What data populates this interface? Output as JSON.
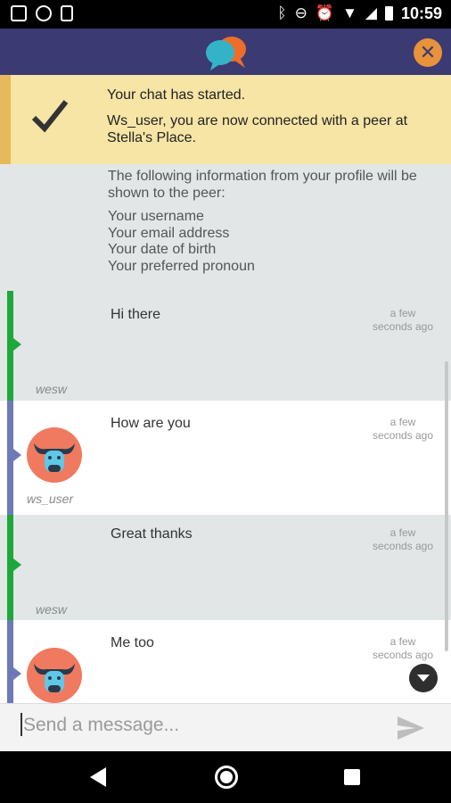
{
  "status_bar": {
    "time": "10:59",
    "left_icons": [
      "image-icon",
      "sync-icon",
      "phone-icon"
    ],
    "right_icons": [
      "bluetooth-icon",
      "dnd-icon",
      "alarm-icon",
      "wifi-icon",
      "signal-icon",
      "battery-icon"
    ]
  },
  "app_bar": {
    "logo_icon": "chat-bubbles-logo",
    "close_icon": "close-icon",
    "colors": {
      "background": "#3b3a73",
      "close": "#e8923a"
    }
  },
  "banner": {
    "title": "Your chat has started.",
    "text": "Ws_user, you are now connected with a peer at Stella's Place.",
    "icon": "checkmark-icon",
    "colors": {
      "background": "#f7e5a6",
      "stripe": "#e6b95a"
    }
  },
  "info": {
    "intro": "The following information from your profile will be shown to the peer:",
    "items": [
      "Your username",
      "Your email address",
      "Your date of birth",
      "Your preferred pronoun"
    ]
  },
  "messages": [
    {
      "text": "Hi there",
      "time": "a few seconds ago",
      "user": "wesw",
      "side": "peer"
    },
    {
      "text": "How are you",
      "time": "a few seconds ago",
      "user": "ws_user",
      "side": "self"
    },
    {
      "text": "Great thanks",
      "time": "a few seconds ago",
      "user": "wesw",
      "side": "peer"
    },
    {
      "text": "Me too",
      "time": "a few seconds ago",
      "user": "",
      "side": "self"
    }
  ],
  "composer": {
    "placeholder": "Send a message...",
    "send_icon": "send-icon"
  },
  "colors": {
    "peer_bar": "#1ea83c",
    "self_bar": "#6e7ab8",
    "avatar": "#ef7a5f"
  }
}
